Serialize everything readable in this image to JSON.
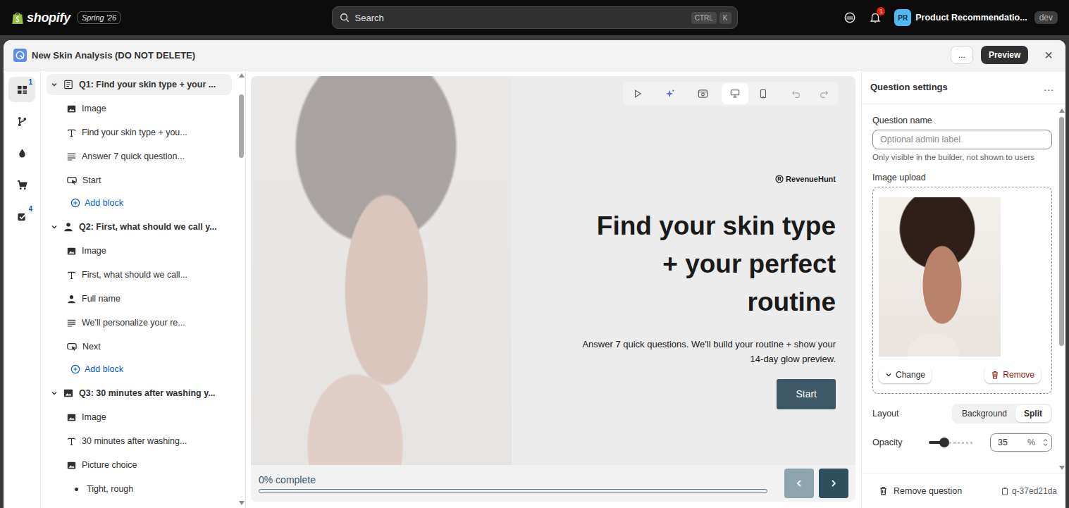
{
  "topbar": {
    "brand": "shopify",
    "edition": "Spring '26",
    "search": {
      "placeholder": "Search",
      "keys": [
        "CTRL",
        "K"
      ]
    },
    "notifications": "1",
    "avatar": "PR",
    "store": "Product Recommendatio...",
    "env": "dev"
  },
  "window": {
    "title": "New Skin Analysis (DO NOT DELETE)",
    "more": "...",
    "preview": "Preview",
    "close": "×"
  },
  "rail": [
    {
      "kind": "questions",
      "badge": "1",
      "selected": true
    },
    {
      "kind": "logic",
      "selected": false
    },
    {
      "kind": "design",
      "selected": false
    },
    {
      "kind": "products",
      "selected": false
    },
    {
      "kind": "results",
      "badge": "4",
      "selected": false
    }
  ],
  "tree": [
    {
      "label": "Q1: Find your skin type + your ...",
      "kind": "welcome",
      "expanded": true,
      "selected": true,
      "add_block": "Add block",
      "blocks": [
        {
          "label": "Image",
          "kind": "image"
        },
        {
          "label": "Find your skin type + you...",
          "kind": "heading"
        },
        {
          "label": "Answer 7 quick question...",
          "kind": "paragraph"
        },
        {
          "label": "Start",
          "kind": "button"
        }
      ]
    },
    {
      "label": "Q2: First, what should we call y...",
      "kind": "contact",
      "expanded": true,
      "selected": false,
      "add_block": "Add block",
      "blocks": [
        {
          "label": "Image",
          "kind": "image"
        },
        {
          "label": "First, what should we call...",
          "kind": "heading"
        },
        {
          "label": "Full name",
          "kind": "name"
        },
        {
          "label": "We'll personalize your re...",
          "kind": "paragraph"
        },
        {
          "label": "Next",
          "kind": "button"
        }
      ]
    },
    {
      "label": "Q3: 30 minutes after washing y...",
      "kind": "picture",
      "expanded": true,
      "selected": false,
      "blocks": [
        {
          "label": "Image",
          "kind": "image"
        },
        {
          "label": "30 minutes after washing...",
          "kind": "heading"
        },
        {
          "label": "Picture choice",
          "kind": "image"
        },
        {
          "label": "Tight, rough",
          "kind": "choice"
        }
      ]
    }
  ],
  "canvas": {
    "toolbar": [
      {
        "kind": "play",
        "selected": false,
        "disabled": false
      },
      {
        "kind": "ai",
        "selected": false,
        "disabled": false
      },
      {
        "kind": "preview",
        "selected": false,
        "disabled": false
      },
      {
        "kind": "desktop",
        "selected": true,
        "disabled": false
      },
      {
        "kind": "mobile",
        "selected": false,
        "disabled": false
      },
      {
        "kind": "undo",
        "selected": false,
        "disabled": true
      },
      {
        "kind": "redo",
        "selected": false,
        "disabled": true
      }
    ],
    "logo": "RevenueHunt",
    "heading": "Find your skin type + your perfect routine",
    "subtitle": "Answer 7 quick questions. We'll build your routine + show your 14-day glow preview.",
    "cta": "Start",
    "progress": {
      "label": "0% complete",
      "level": 0
    },
    "nav": [
      {
        "kind": "prev",
        "disabled": true
      },
      {
        "kind": "next",
        "disabled": false
      }
    ]
  },
  "settings": {
    "title": "Question settings",
    "more": "...",
    "question_name": {
      "label": "Question name",
      "placeholder": "Optional admin label",
      "help": "Only visible in the builder, not shown to users"
    },
    "image_upload": {
      "label": "Image upload",
      "change": "Change",
      "remove": "Remove"
    },
    "layout": {
      "label": "Layout",
      "options": [
        {
          "label": "Background",
          "selected": false
        },
        {
          "label": "Split",
          "selected": true
        }
      ]
    },
    "opacity": {
      "label": "Opacity",
      "level": 0.35,
      "value": "35",
      "unit": "%"
    },
    "footer": {
      "remove": "Remove question",
      "id": "q-37ed21da"
    }
  }
}
